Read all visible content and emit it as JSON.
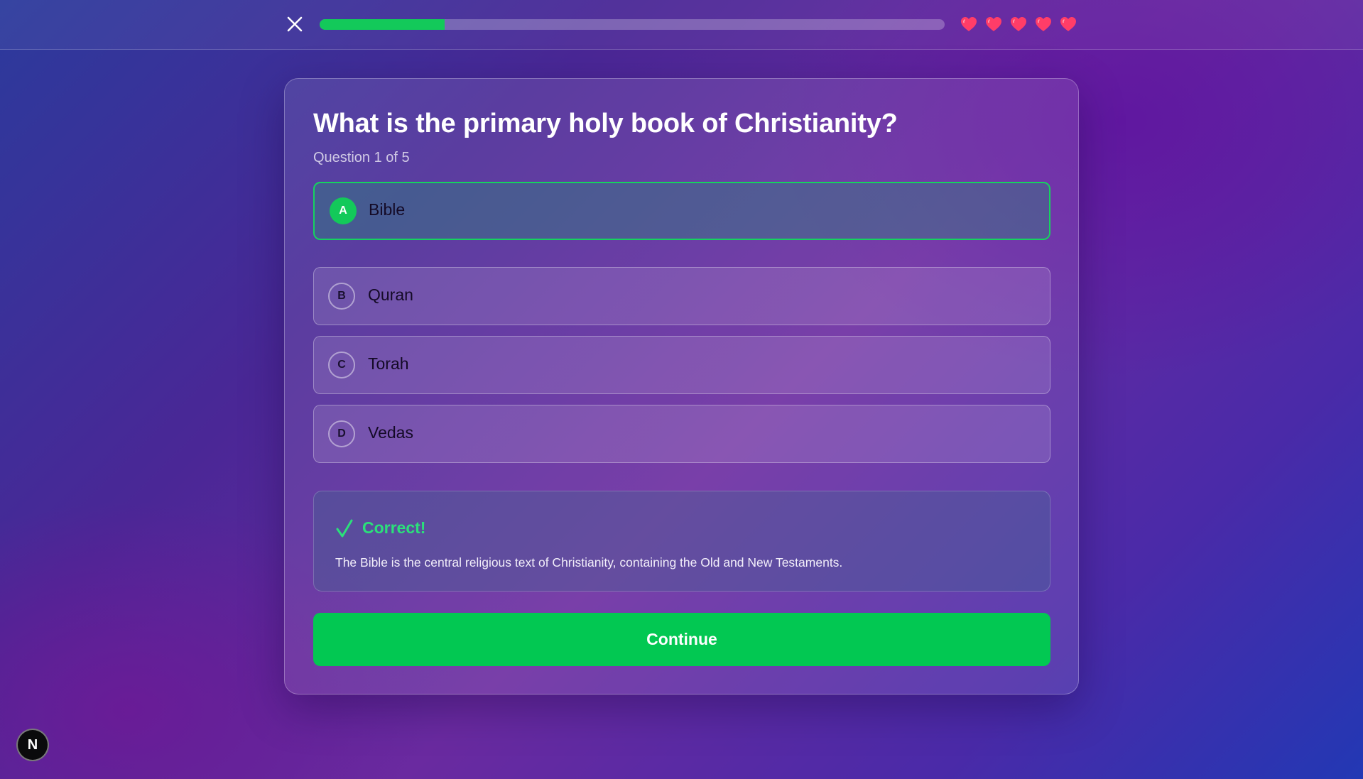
{
  "header": {
    "close_icon": "close-icon",
    "progress": 0.2,
    "lives": 5,
    "heart_icon": "heart-icon",
    "heart_color": "#ff3d68"
  },
  "quiz": {
    "question": "What is the primary holy book of Christianity?",
    "counter": "Question 1 of 5",
    "options": [
      {
        "letter": "A",
        "label": "Bible",
        "state": "correct"
      },
      {
        "letter": "B",
        "label": "Quran",
        "state": "default"
      },
      {
        "letter": "C",
        "label": "Torah",
        "state": "default"
      },
      {
        "letter": "D",
        "label": "Vedas",
        "state": "default"
      }
    ],
    "feedback": {
      "icon": "check-icon",
      "title": "Correct!",
      "text": "The Bible is the central religious text of Christianity, containing the Old and New Testaments."
    },
    "continue_label": "Continue"
  },
  "dev_badge": {
    "label": "N"
  },
  "colors": {
    "accent_green": "#02c852",
    "correct_text": "#2be07a"
  }
}
